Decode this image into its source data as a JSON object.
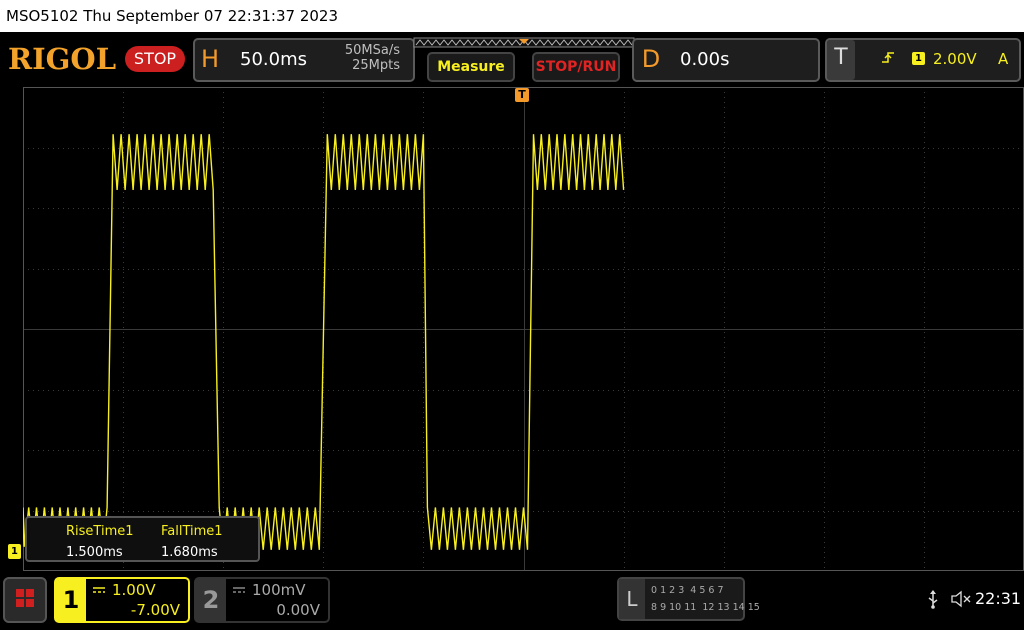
{
  "title_bar": {
    "text": "MSO5102  Thu September 07 22:31:37 2023"
  },
  "header": {
    "logo": "RIGOL",
    "run_state": "STOP",
    "horizontal": {
      "letter": "H",
      "timebase": "50.0ms",
      "sample_rate": "50MSa/s",
      "memory_depth": "25Mpts"
    },
    "measure_label": "Measure",
    "stop_run_label": "STOP/RUN",
    "delay": {
      "letter": "D",
      "value": "0.00s"
    },
    "trigger": {
      "letter": "T",
      "source": "1",
      "level": "2.00V",
      "mode": "A"
    }
  },
  "markers": {
    "trigger_marker": "T",
    "channel1_ground": "1"
  },
  "measurements": {
    "items": [
      {
        "name": "RiseTime1",
        "value": "1.500ms"
      },
      {
        "name": "FallTime1",
        "value": "1.680ms"
      }
    ]
  },
  "channels": {
    "ch1": {
      "number": "1",
      "scale": "1.00V",
      "offset": "-7.00V"
    },
    "ch2": {
      "number": "2",
      "scale": "100mV",
      "offset": "0.00V"
    }
  },
  "logic": {
    "letter": "L",
    "row1": "0 1 2 3  4 5 6 7",
    "row2": "8 9 10 11  12 13 14 15"
  },
  "status": {
    "time": "22:31"
  },
  "colors": {
    "channel1": "#f7ef1f",
    "accent_orange": "#f39a2b",
    "stop_red": "#cc1f1f",
    "grid": "#3a3a3a"
  },
  "chart_data": {
    "type": "line",
    "title": "",
    "xlabel": "",
    "ylabel": "",
    "x_divisions": 10,
    "y_divisions": 8,
    "time_per_div_ms": 50,
    "volts_per_div": 1.0,
    "series": [
      {
        "segments": [
          {
            "t_start_ms": -255,
            "t_end_ms": -208,
            "level_div": -3.0,
            "ripple_div": 0.6
          },
          {
            "t_start_ms": -205,
            "t_end_ms": -155,
            "level_div": 3.0,
            "ripple_div": 0.7
          },
          {
            "t_start_ms": -152,
            "t_end_ms": -102,
            "level_div": -3.0,
            "ripple_div": 0.65
          },
          {
            "t_start_ms": -98,
            "t_end_ms": -50,
            "level_div": 3.0,
            "ripple_div": 0.7
          },
          {
            "t_start_ms": -48,
            "t_end_ms": 2,
            "level_div": -3.0,
            "ripple_div": 0.65
          },
          {
            "t_start_ms": 5,
            "t_end_ms": 50,
            "level_div": 3.0,
            "ripple_div": 0.7
          }
        ]
      }
    ]
  }
}
